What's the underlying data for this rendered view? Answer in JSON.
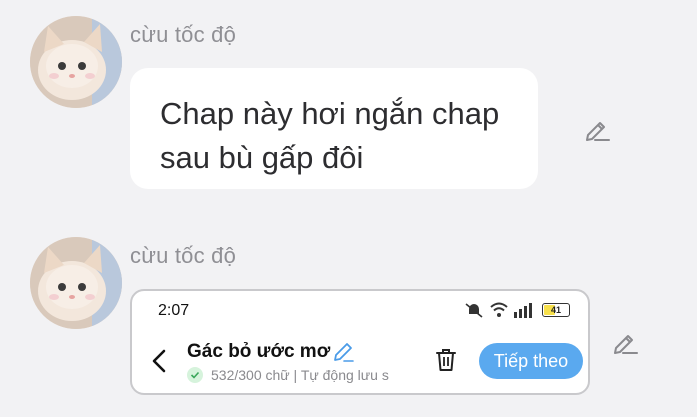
{
  "messages": [
    {
      "sender": "cừu tốc độ",
      "text": "Chap này hơi ngắn chap sau bù gấp đôi",
      "avatar_icon": "cat-avatar",
      "action_icon": "edit-pencil-icon"
    },
    {
      "sender": "cừu tốc độ",
      "avatar_icon": "cat-avatar",
      "action_icon": "edit-pencil-icon",
      "screenshot": {
        "status_bar": {
          "time": "2:07",
          "battery": "41"
        },
        "title": "Gác bỏ ước mơ",
        "meta": "532/300 chữ | Tự động lưu s",
        "next_label": "Tiếp theo"
      }
    }
  ],
  "colors": {
    "background": "#f2f2f4",
    "bubble": "#ffffff",
    "accent": "#5aa9ef",
    "sender": "#8f8f94"
  }
}
